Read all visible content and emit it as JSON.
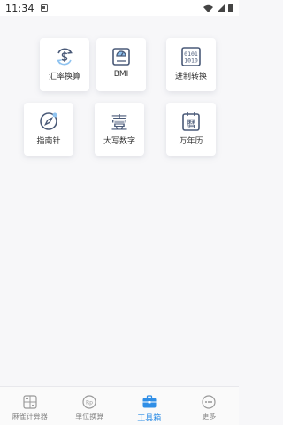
{
  "status": {
    "time": "11:34"
  },
  "tools": [
    {
      "label": "汇率换算",
      "icon": "currency-exchange-icon"
    },
    {
      "label": "BMI",
      "icon": "bmi-scale-icon"
    },
    {
      "label": "进制转换",
      "icon": "binary-convert-icon"
    },
    {
      "label": "指南针",
      "icon": "compass-icon"
    },
    {
      "label": "大写数字",
      "icon": "uppercase-number-icon",
      "glyph": "壹"
    },
    {
      "label": "万年历",
      "icon": "calendar-icon",
      "glyph": "曆"
    }
  ],
  "tabs": [
    {
      "label": "麻雀计算器",
      "icon": "calculator-icon"
    },
    {
      "label": "单位换算",
      "icon": "unit-convert-icon"
    },
    {
      "label": "工具箱",
      "icon": "toolbox-icon",
      "active": true
    },
    {
      "label": "更多",
      "icon": "more-icon"
    }
  ],
  "colors": {
    "accent": "#2f8ee6",
    "icon": "#4a5a78",
    "icon_light": "#8fc3f0"
  }
}
